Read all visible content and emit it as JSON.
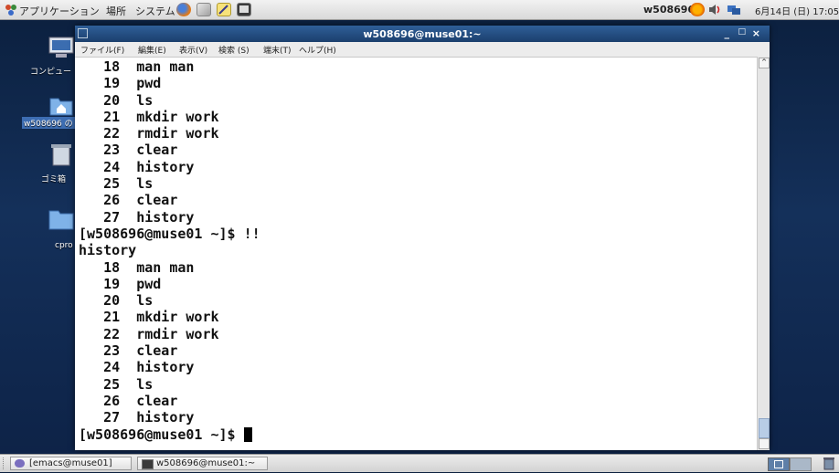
{
  "top_panel": {
    "applications": "アプリケーション",
    "places": "場所",
    "system": "システム",
    "username": "w508696",
    "datetime": "6月14日 (日) 17:05"
  },
  "desktop": {
    "icons": [
      {
        "label": "コンピュー"
      },
      {
        "label": "w508696 の"
      },
      {
        "label": "ゴミ箱"
      },
      {
        "label": "cpro"
      }
    ]
  },
  "terminal": {
    "title": "w508696@muse01:~",
    "menu": [
      "ファイル(F)",
      "編集(E)",
      "表示(V)",
      "検索 (S)",
      "端末(T)",
      "ヘルプ(H)"
    ],
    "lines": [
      "   18  man man",
      "   19  pwd",
      "   20  ls",
      "   21  mkdir work",
      "   22  rmdir work",
      "   23  clear",
      "   24  history",
      "   25  ls",
      "   26  clear",
      "   27  history",
      "[w508696@muse01 ~]$ !!",
      "history",
      "   18  man man",
      "   19  pwd",
      "   20  ls",
      "   21  mkdir work",
      "   22  rmdir work",
      "   23  clear",
      "   24  history",
      "   25  ls",
      "   26  clear",
      "   27  history"
    ],
    "prompt": "[w508696@muse01 ~]$ "
  },
  "taskbar": {
    "tasks": [
      {
        "label": "[emacs@muse01]"
      },
      {
        "label": "w508696@muse01:~"
      }
    ]
  }
}
